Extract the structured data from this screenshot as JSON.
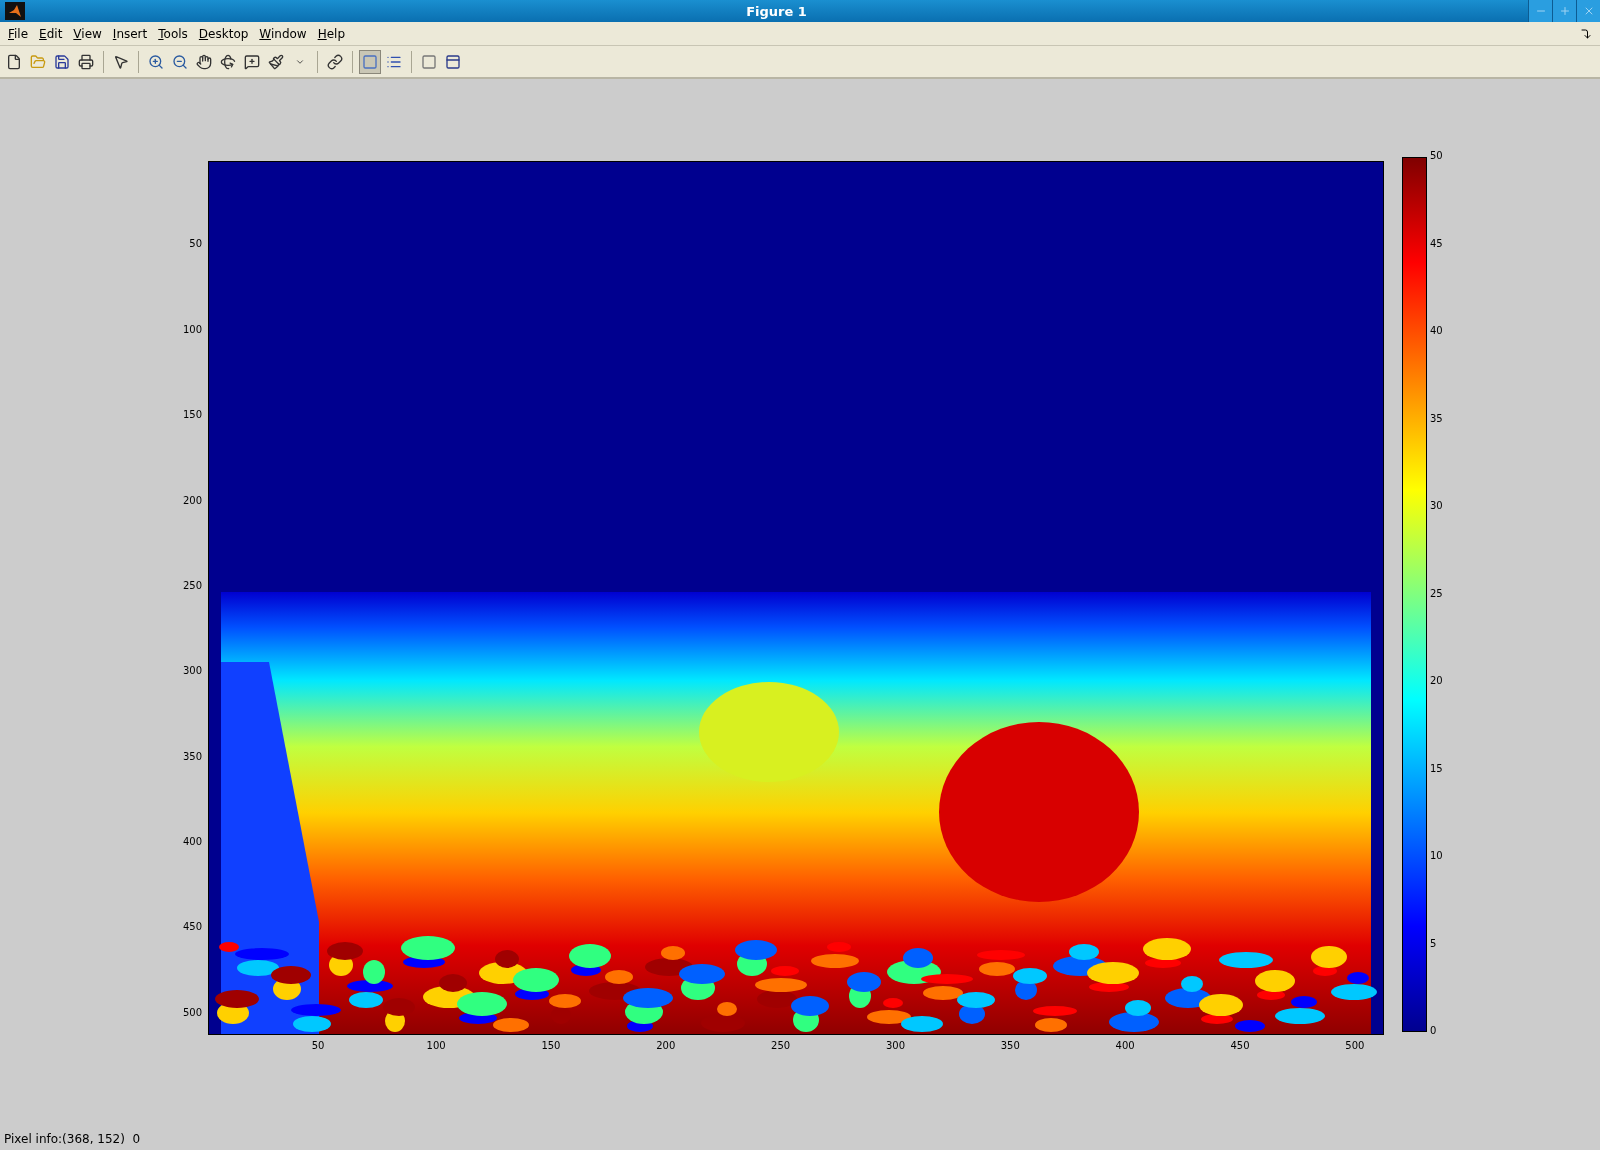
{
  "window": {
    "title": "Figure 1"
  },
  "menu": [
    "File",
    "Edit",
    "View",
    "Insert",
    "Tools",
    "Desktop",
    "Window",
    "Help"
  ],
  "toolbar": [
    {
      "kind": "new",
      "pressed": false
    },
    {
      "kind": "open",
      "pressed": false
    },
    {
      "kind": "save",
      "pressed": false
    },
    {
      "kind": "print",
      "pressed": false
    },
    {
      "kind": "separator"
    },
    {
      "kind": "pointer",
      "pressed": false
    },
    {
      "kind": "separator"
    },
    {
      "kind": "zoom-in",
      "pressed": false
    },
    {
      "kind": "zoom-out",
      "pressed": false
    },
    {
      "kind": "pan",
      "pressed": false
    },
    {
      "kind": "rotate",
      "pressed": false
    },
    {
      "kind": "data-cursor",
      "pressed": false
    },
    {
      "kind": "brush",
      "pressed": false
    },
    {
      "kind": "dropdown",
      "pressed": false
    },
    {
      "kind": "separator"
    },
    {
      "kind": "link",
      "pressed": false
    },
    {
      "kind": "separator"
    },
    {
      "kind": "colorbar",
      "pressed": true
    },
    {
      "kind": "legend",
      "pressed": false
    },
    {
      "kind": "separator"
    },
    {
      "kind": "hide-tools",
      "pressed": false
    },
    {
      "kind": "show-tools",
      "pressed": false
    }
  ],
  "axes": {
    "xticks": [
      "50",
      "100",
      "150",
      "200",
      "250",
      "300",
      "350",
      "400",
      "450",
      "500"
    ],
    "yticks": [
      "50",
      "100",
      "150",
      "200",
      "250",
      "300",
      "350",
      "400",
      "450",
      "500"
    ]
  },
  "colorbar": {
    "ticks": [
      "50",
      "45",
      "40",
      "35",
      "30",
      "25",
      "20",
      "15",
      "10",
      "5",
      "0"
    ]
  },
  "status_bar": {
    "text": "Pixel info:(368, 152)  0"
  }
}
